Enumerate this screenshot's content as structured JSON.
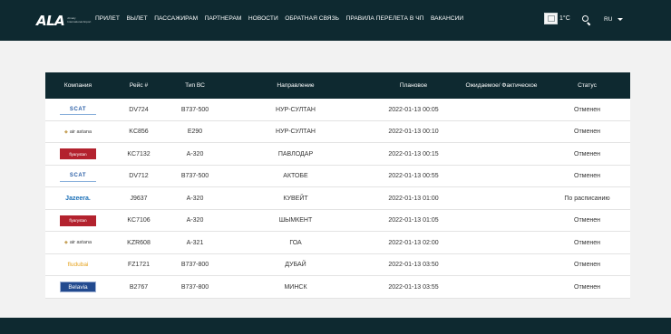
{
  "header": {
    "logo_text": "ALA",
    "logo_subtext": "Almaty International Airport",
    "nav": [
      {
        "label": "ПРИЛЕТ"
      },
      {
        "label": "ВЫЛЕТ"
      },
      {
        "label": "ПАССАЖИРАМ"
      },
      {
        "label": "ПАРТНЕРАМ"
      },
      {
        "label": "НОВОСТИ"
      },
      {
        "label": "ОБРАТНАЯ СВЯЗЬ"
      },
      {
        "label": "ПРАВИЛА ПЕРЕЛЕТА В ЧП"
      },
      {
        "label": "ВАКАНСИИ"
      }
    ],
    "weather": {
      "temperature": "1°C",
      "icon": "weather-icon"
    },
    "language": "RU"
  },
  "table": {
    "headers": {
      "company": "Компания",
      "flight": "Рейс #",
      "aircraft": "Тип ВС",
      "destination": "Направление",
      "scheduled": "Плановое",
      "expected": "Ожидаемое/ Фактическое",
      "status": "Статус"
    },
    "rows": [
      {
        "airline_logo": "SCAT",
        "flight": "DV724",
        "aircraft": "B737-500",
        "destination": "НУР-СУЛТАН",
        "scheduled": "2022-01-13 00:05",
        "expected": "",
        "status": "Отменен"
      },
      {
        "airline_logo": "air astana",
        "flight": "KC856",
        "aircraft": "E290",
        "destination": "НУР-СУЛТАН",
        "scheduled": "2022-01-13 00:10",
        "expected": "",
        "status": "Отменен"
      },
      {
        "airline_logo": "flyarystan",
        "flight": "KC7132",
        "aircraft": "A-320",
        "destination": "ПАВЛОДАР",
        "scheduled": "2022-01-13 00:15",
        "expected": "",
        "status": "Отменен"
      },
      {
        "airline_logo": "SCAT",
        "flight": "DV712",
        "aircraft": "B737-500",
        "destination": "АКТОБЕ",
        "scheduled": "2022-01-13 00:55",
        "expected": "",
        "status": "Отменен"
      },
      {
        "airline_logo": "Jazeera.",
        "flight": "J9637",
        "aircraft": "A-320",
        "destination": "КУВЕЙТ",
        "scheduled": "2022-01-13 01:00",
        "expected": "",
        "status": "По расписанию"
      },
      {
        "airline_logo": "flyarystan",
        "flight": "KC7106",
        "aircraft": "A-320",
        "destination": "ШЫМКЕНТ",
        "scheduled": "2022-01-13 01:05",
        "expected": "",
        "status": "Отменен"
      },
      {
        "airline_logo": "air astana",
        "flight": "KZR608",
        "aircraft": "A-321",
        "destination": "ГОА",
        "scheduled": "2022-01-13 02:00",
        "expected": "",
        "status": "Отменен"
      },
      {
        "airline_logo": "fludubai",
        "flight": "FZ1721",
        "aircraft": "B737-800",
        "destination": "ДУБАЙ",
        "scheduled": "2022-01-13 03:50",
        "expected": "",
        "status": "Отменен"
      },
      {
        "airline_logo": "Belavia",
        "flight": "B2767",
        "aircraft": "B737-800",
        "destination": "МИНСК",
        "scheduled": "2022-01-13 03:55",
        "expected": "",
        "status": "Отменен"
      }
    ]
  }
}
